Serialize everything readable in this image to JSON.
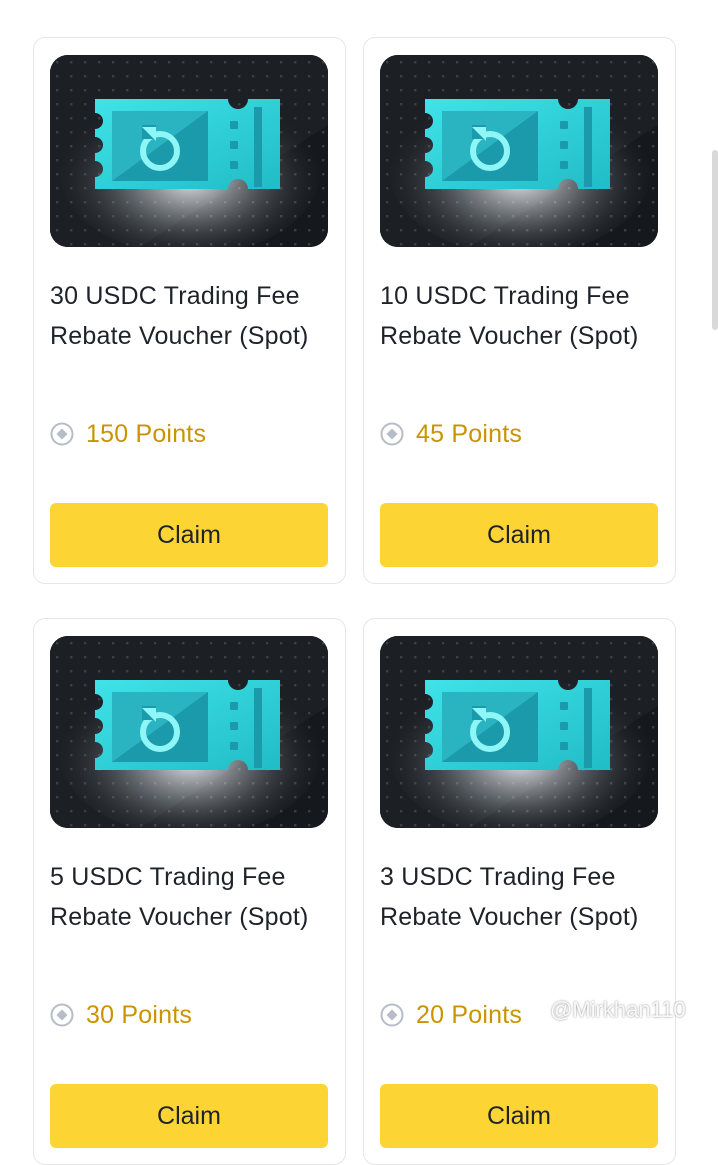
{
  "colors": {
    "accent_button": "#fcd535",
    "points_text": "#c99400",
    "voucher_teal": "#2fd0d6"
  },
  "vouchers": [
    {
      "icon": "rebate-voucher-icon",
      "title": "30 USDC Trading Fee Rebate Voucher (Spot)",
      "points": "150 Points",
      "button_label": "Claim"
    },
    {
      "icon": "rebate-voucher-icon",
      "title": "10 USDC Trading Fee Rebate Voucher (Spot)",
      "points": "45 Points",
      "button_label": "Claim"
    },
    {
      "icon": "rebate-voucher-icon",
      "title": "5 USDC Trading Fee Rebate Voucher (Spot)",
      "points": "30 Points",
      "button_label": "Claim"
    },
    {
      "icon": "rebate-voucher-icon",
      "title": "3 USDC Trading Fee Rebate Voucher (Spot)",
      "points": "20 Points",
      "button_label": "Claim"
    }
  ],
  "watermark": {
    "text": "@Mirkhan110"
  }
}
